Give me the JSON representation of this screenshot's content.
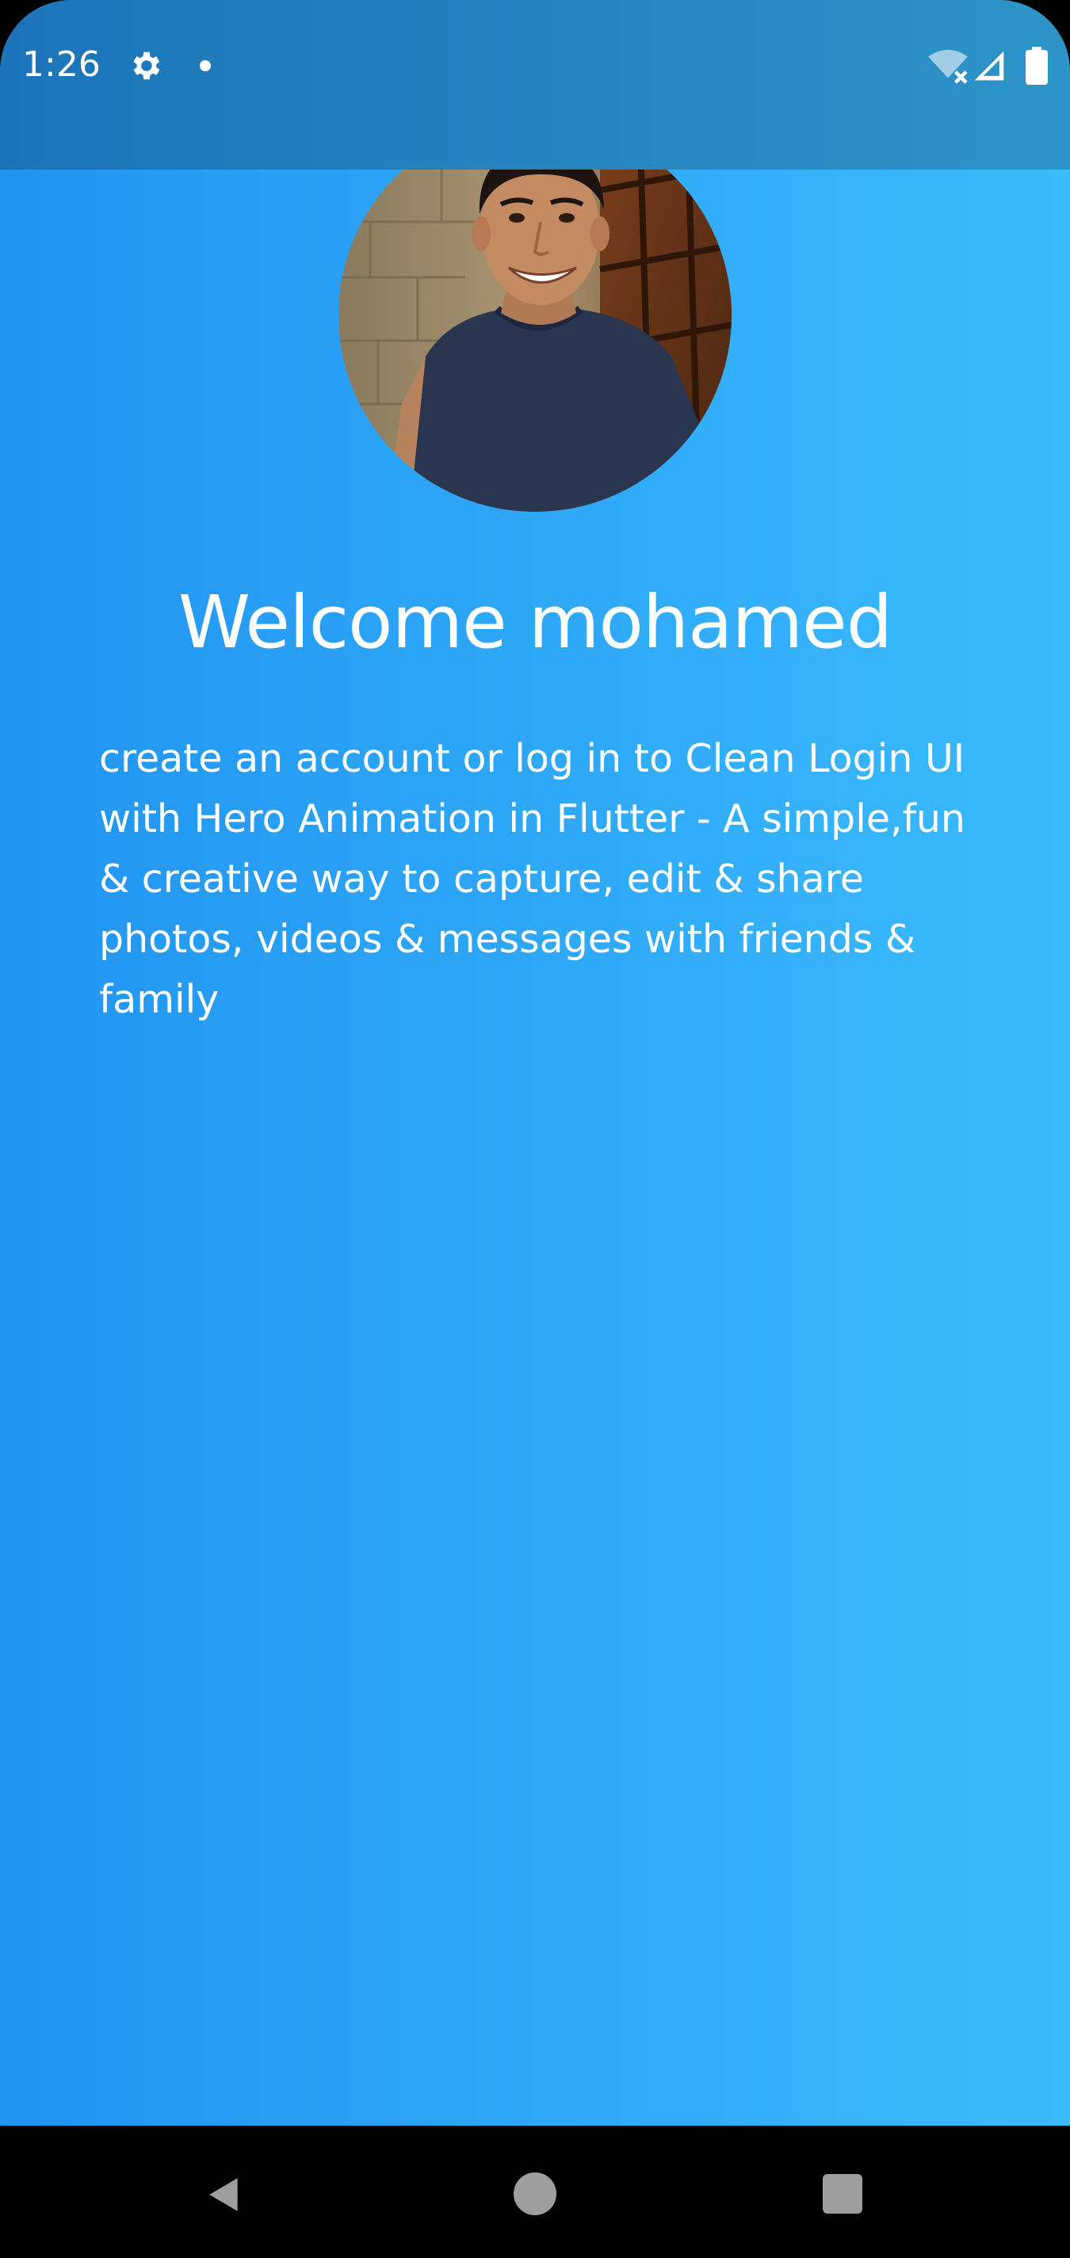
{
  "status_bar": {
    "time": "1:26",
    "icons": [
      "gear-icon",
      "notification-dot-icon",
      "wifi-off-icon",
      "cell-signal-icon",
      "battery-icon"
    ]
  },
  "profile": {
    "avatar_alt": "profile photo",
    "welcome_text": "Welcome mohamed",
    "description": "create an account or log in to Clean Login UI with Hero Animation in Flutter  - A simple,fun & creative way to capture, edit & share photos, videos & messages with friends & family"
  },
  "nav_bar": {
    "icons": [
      "back-icon",
      "home-icon",
      "recents-icon"
    ]
  },
  "colors": {
    "gradient_start": "#2194f1",
    "gradient_end": "#3bbbfd",
    "status_bar": "#1b74b8",
    "text": "#ffffff"
  }
}
